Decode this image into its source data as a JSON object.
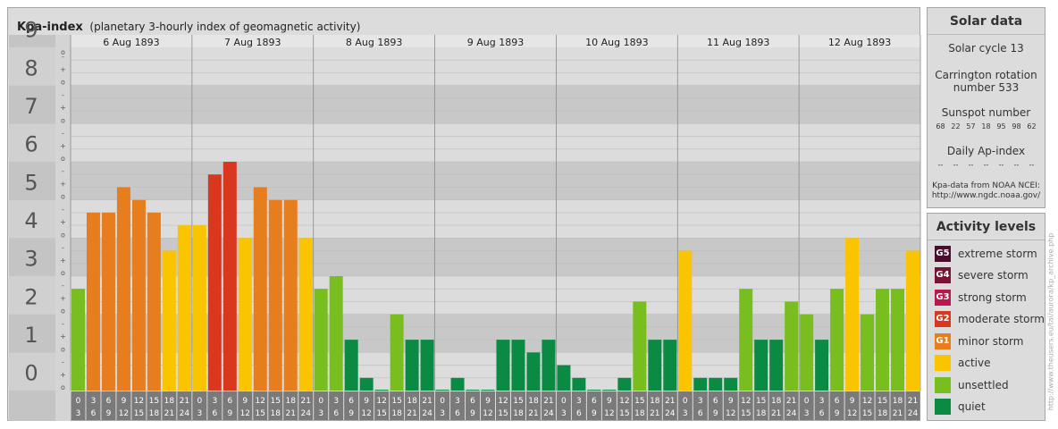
{
  "title": {
    "main": "Kpa-index",
    "sub": "(planetary 3-hourly index of geomagnetic activity)"
  },
  "chart_data": {
    "type": "bar",
    "title": "Kpa-index",
    "subtitle": "(planetary 3-hourly index of geomagnetic activity)",
    "ylim": [
      0,
      9
    ],
    "y_ticks": [
      "0",
      "1",
      "2",
      "3",
      "4",
      "5",
      "6",
      "7",
      "8",
      "9"
    ],
    "y_minor_ticks": [
      "o",
      "+",
      "-"
    ],
    "days": [
      "6 Aug 1893",
      "7 Aug 1893",
      "8 Aug 1893",
      "9 Aug 1893",
      "10 Aug 1893",
      "11 Aug 1893",
      "12 Aug 1893"
    ],
    "slot_labels": [
      {
        "top": "0",
        "bottom": "3"
      },
      {
        "top": "3",
        "bottom": "6"
      },
      {
        "top": "6",
        "bottom": "9"
      },
      {
        "top": "9",
        "bottom": "12"
      },
      {
        "top": "12",
        "bottom": "15"
      },
      {
        "top": "15",
        "bottom": "18"
      },
      {
        "top": "18",
        "bottom": "21"
      },
      {
        "top": "21",
        "bottom": "24"
      }
    ],
    "values": [
      2.667,
      4.667,
      4.667,
      5.333,
      5.0,
      4.667,
      3.667,
      4.333,
      4.333,
      5.667,
      6.0,
      4.0,
      5.333,
      5.0,
      5.0,
      4.0,
      2.667,
      3.0,
      1.333,
      0.333,
      0.0,
      2.0,
      1.333,
      1.333,
      0.0,
      0.333,
      0.0,
      0.0,
      1.333,
      1.333,
      1.0,
      1.333,
      0.667,
      0.333,
      0.0,
      0.0,
      0.333,
      2.333,
      1.333,
      1.333,
      3.667,
      0.333,
      0.333,
      0.333,
      2.667,
      1.333,
      1.333,
      2.333,
      2.0,
      1.333,
      2.667,
      4.0,
      2.0,
      2.667,
      2.667,
      3.667
    ],
    "grid": true,
    "colors": {
      "quiet": "#0a8a43",
      "unsettled": "#77be1e",
      "active": "#fac400",
      "minor_storm": "#e67e1e",
      "moderate_storm": "#d9381e",
      "band_dark": "#c8c8c8",
      "band_light": "#dcdcdc",
      "label_bg": "#7a7a7a"
    }
  },
  "solar_data": {
    "title": "Solar data",
    "cycle": "Solar cycle 13",
    "carrington_line1": "Carrington rotation",
    "carrington_line2": "number 533",
    "sunspot_title": "Sunspot number",
    "sunspot_values": [
      "68",
      "22",
      "57",
      "18",
      "95",
      "98",
      "62"
    ],
    "ap_title": "Daily Ap-index",
    "ap_values": [
      "--",
      "--",
      "--",
      "--",
      "--",
      "--",
      "--"
    ],
    "source_line1": "Kpa-data from NOAA NCEI:",
    "source_line2": "http://www.ngdc.noaa.gov/"
  },
  "activity_levels": {
    "title": "Activity levels",
    "items": [
      {
        "code": "G5",
        "label": "extreme storm",
        "color": "#4a0d2e"
      },
      {
        "code": "G4",
        "label": "severe storm",
        "color": "#7a1238"
      },
      {
        "code": "G3",
        "label": "strong storm",
        "color": "#b8174f"
      },
      {
        "code": "G2",
        "label": "moderate storm",
        "color": "#d9381e"
      },
      {
        "code": "G1",
        "label": "minor storm",
        "color": "#e67e1e"
      },
      {
        "code": "",
        "label": "active",
        "color": "#fac400"
      },
      {
        "code": "",
        "label": "unsettled",
        "color": "#77be1e"
      },
      {
        "code": "",
        "label": "quiet",
        "color": "#0a8a43"
      }
    ]
  },
  "side_url": "http://www.theusers.eu/tai/aurora/kp_archive.php"
}
